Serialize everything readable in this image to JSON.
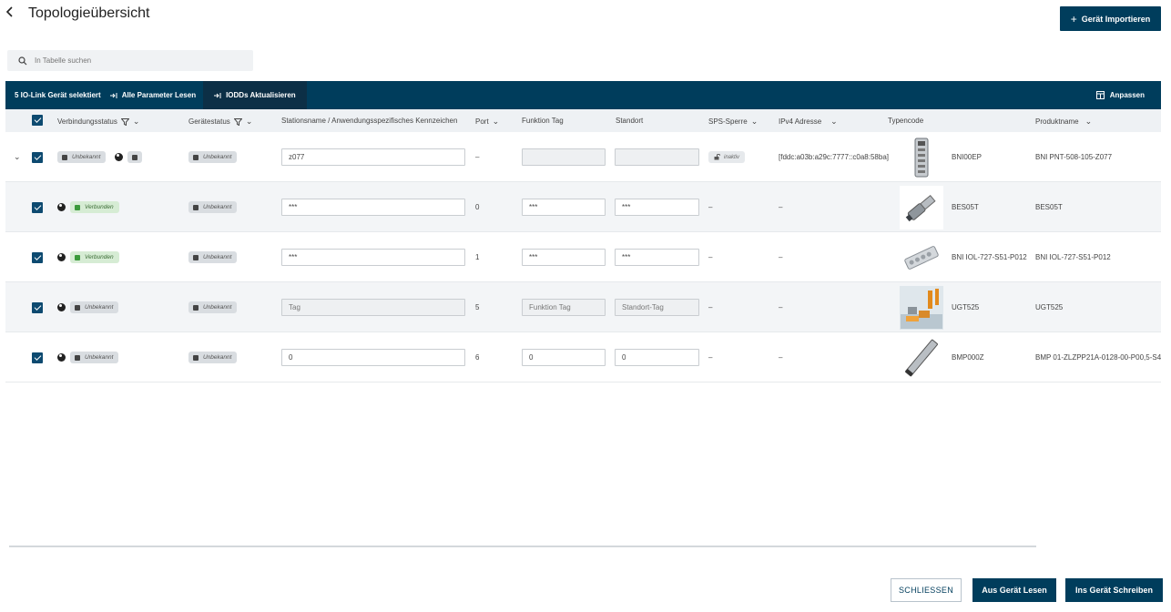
{
  "header": {
    "back_icon": "chevron-left-icon",
    "title": "Topologieübersicht",
    "import_label": "Gerät Importieren"
  },
  "search": {
    "placeholder": "In Tabelle suchen"
  },
  "action_bar": {
    "selected_text": "5 IO-Link Gerät selektiert",
    "read_all_label": "Alle Parameter Lesen",
    "update_iodd_label": "IODDs Aktualisieren",
    "adjust_label": "Anpassen"
  },
  "columns": {
    "connection_status": "Verbindungsstatus",
    "device_status": "Gerätestatus",
    "station_name": "Stationsname / Anwendungsspezifisches Kennzeichen",
    "port": "Port",
    "function_tag": "Funktion Tag",
    "location": "Standort",
    "sps_lock": "SPS-Sperre",
    "ipv4": "IPv4 Adresse",
    "type_code": "Typencode",
    "product_name": "Produktname"
  },
  "rows": [
    {
      "checked": true,
      "expandable": true,
      "connection_status": "Unbekannt",
      "device_status": "Unbekannt",
      "station_name": "z077",
      "port": "–",
      "function_tag": "",
      "location": "",
      "sps_lock": "inaktiv",
      "ipv4": "[fddc:a03b:a29c:7777::c0a8:58ba]",
      "type_code": "BNI00EP",
      "product_name": "BNI PNT-508-105-Z077"
    },
    {
      "checked": true,
      "connection_status": "Verbunden",
      "device_status": "Unbekannt",
      "station_name": "***",
      "port": "0",
      "function_tag": "***",
      "location": "***",
      "sps_lock": "–",
      "ipv4": "–",
      "type_code": "BES05T",
      "product_name": "BES05T"
    },
    {
      "checked": true,
      "connection_status": "Verbunden",
      "device_status": "Unbekannt",
      "station_name": "***",
      "port": "1",
      "function_tag": "***",
      "location": "***",
      "sps_lock": "–",
      "ipv4": "–",
      "type_code": "BNI IOL-727-S51-P012",
      "product_name": "BNI IOL-727-S51-P012"
    },
    {
      "checked": true,
      "connection_status": "Unbekannt",
      "device_status": "Unbekannt",
      "station_name": "Tag",
      "port": "5",
      "function_tag": "Funktion Tag",
      "location": "Standort-Tag",
      "sps_lock": "–",
      "ipv4": "–",
      "type_code": "UGT525",
      "product_name": "UGT525"
    },
    {
      "checked": true,
      "connection_status": "Unbekannt",
      "device_status": "Unbekannt",
      "station_name": "0",
      "port": "6",
      "function_tag": "0",
      "location": "0",
      "sps_lock": "–",
      "ipv4": "–",
      "type_code": "BMP000Z",
      "product_name": "BMP 01-ZLZPP21A-0128-00-P00,5-S4"
    }
  ],
  "footer": {
    "close_label": "SCHLIESSEN",
    "read_label": "Aus Gerät Lesen",
    "write_label": "Ins Gerät Schreiben"
  },
  "colors": {
    "primary": "#003d5c",
    "header_bg": "#eef1f4",
    "status_connected": "#3b9a3b",
    "status_unknown": "#444444"
  }
}
